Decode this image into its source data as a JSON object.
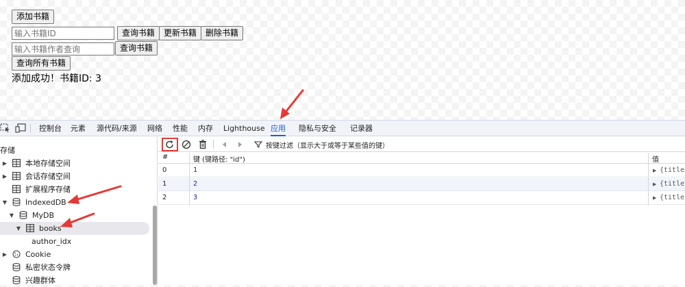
{
  "page": {
    "add_button": "添加书籍",
    "id_input_placeholder": "输入书籍ID",
    "query_button": "查询书籍",
    "update_button": "更新书籍",
    "delete_button": "删除书籍",
    "author_input_placeholder": "输入书籍作者查询",
    "author_query_button": "查询书籍",
    "query_all_button": "查询所有书籍",
    "result_text": "添加成功！书籍ID: 3"
  },
  "devtools": {
    "tabs": [
      "控制台",
      "元素",
      "源代码/来源",
      "网络",
      "性能",
      "内存",
      "Lighthouse",
      "应用",
      "隐私与安全",
      "记录器"
    ],
    "active_tab": "应用",
    "toolbar": {
      "filter_placeholder": "按键过滤（显示大于或等于某些值的键）"
    },
    "sidebar": {
      "section_title": "存储",
      "items": [
        {
          "label": "本地存储空间"
        },
        {
          "label": "会话存储空间"
        },
        {
          "label": "扩展程序存储"
        },
        {
          "label": "IndexedDB"
        },
        {
          "label": "MyDB"
        },
        {
          "label": "books"
        },
        {
          "label": "author_idx"
        },
        {
          "label": "Cookie"
        },
        {
          "label": "私密状态令牌"
        },
        {
          "label": "兴趣群体"
        }
      ]
    },
    "table": {
      "headers": [
        "#",
        "键 (键路径: \"id\")",
        "值"
      ],
      "rows": [
        {
          "index": "0",
          "key": "1",
          "value": "{title:"
        },
        {
          "index": "1",
          "key": "2",
          "value": "{title:"
        },
        {
          "index": "2",
          "key": "3",
          "value": "{title:"
        }
      ]
    },
    "colors": {
      "accent": "#1a5fd0",
      "annotation_red": "#e53935"
    }
  }
}
